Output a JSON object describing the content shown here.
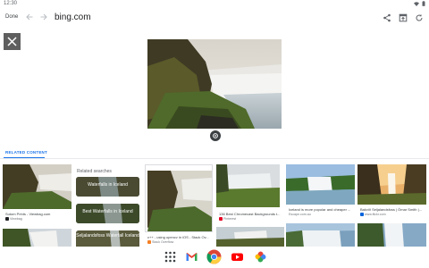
{
  "status_bar": {
    "time": "12:30"
  },
  "toolbar": {
    "done_label": "Done",
    "url": "bing.com"
  },
  "related": {
    "tab_label": "RELATED CONTENT"
  },
  "cards": [
    {
      "caption": "Sutom Prints - Viewbag.com",
      "source": "Viewbag"
    },
    {
      "caption": "c++ - using opencv in iOS - Stack Ov...",
      "source": "Stack Overflow"
    },
    {
      "caption": "136 Best Chromecast Backgrounds t...",
      "source": "Pinterest"
    },
    {
      "caption": "Iceland is more popular and cheaper ...",
      "source": "Escape.com.au"
    },
    {
      "caption": "Bakvið Seljalandsfoss | Ómar Smith |...",
      "source": "www.flickr.com"
    }
  ],
  "related_searches": {
    "title": "Related searches",
    "items": [
      "Waterfalls in Iceland",
      "Best Waterfalls in Iceland",
      "Seljalandsfoss Waterfall Iceland"
    ]
  },
  "colors": {
    "accent": "#1a73e8"
  }
}
